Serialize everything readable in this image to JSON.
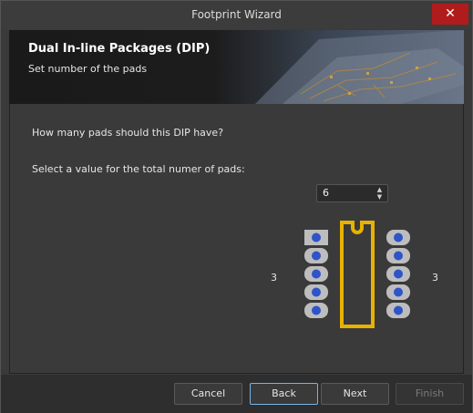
{
  "window": {
    "title": "Footprint Wizard",
    "close_glyph": "✕"
  },
  "banner": {
    "heading": "Dual In-line Packages (DIP)",
    "subheading": "Set number of the pads"
  },
  "content": {
    "question": "How many pads should this DIP have?",
    "prompt": "Select a value for the total numer of pads:",
    "pads": {
      "value": "6"
    },
    "left_count": "3",
    "right_count": "3"
  },
  "buttons": {
    "cancel": "Cancel",
    "back": "Back",
    "next": "Next",
    "finish": "Finish"
  },
  "colors": {
    "package_outline": "#e7b200",
    "pad": "#bdbdbd",
    "pad_hole": "#2e54c8",
    "close": "#b01c1c",
    "focus": "#7ab2e6"
  }
}
